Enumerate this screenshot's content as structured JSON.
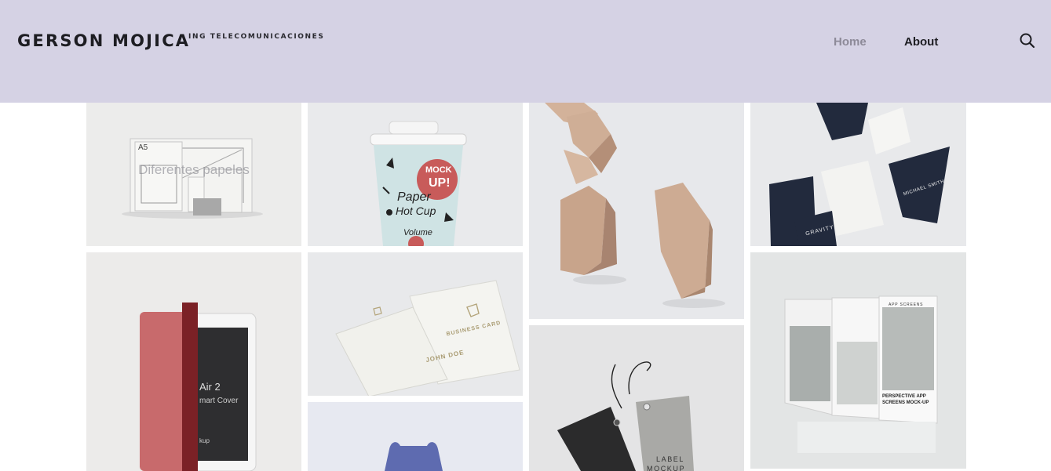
{
  "header": {
    "brand": "GERSON MOJICA",
    "tagline": "ING TELECOMUNICACIONES",
    "nav": {
      "home": "Home",
      "about": "About"
    },
    "search_icon": "search-icon",
    "background": "#d5d2e4"
  },
  "gallery": {
    "tiles": [
      {
        "name": "papers-mockup",
        "overlay_title": "Diferentes papeles",
        "card_label": "A5"
      },
      {
        "name": "paper-cup-mockup",
        "cup_lines": [
          "MOCK",
          "UP!",
          "Paper",
          "Hot Cup",
          "Volume"
        ]
      },
      {
        "name": "wooden-blocks-mockup"
      },
      {
        "name": "gravity-business-cards-mockup",
        "card_label": "GRAVITY",
        "card_name": "MICHAEL SMITH"
      },
      {
        "name": "ipad-smart-cover-mockup",
        "screen_lines": [
          "Air 2",
          "mart Cover",
          "kup"
        ]
      },
      {
        "name": "business-card-mockup",
        "card_title": "BUSINESS CARD",
        "card_name": "JOHN DOE"
      },
      {
        "name": "wooden-tag-mockup",
        "tag_lines": [
          "LABEL",
          "MOCKUP"
        ]
      },
      {
        "name": "app-screens-mockup",
        "screen_title": "APP SCREENS",
        "caption": "PERSPECTIVE APP SCREENS MOCK-UP"
      },
      {
        "name": "tank-top-mockup"
      }
    ]
  }
}
